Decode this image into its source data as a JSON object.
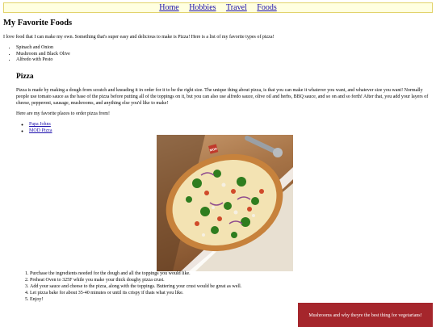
{
  "nav": {
    "items": [
      {
        "label": "Home"
      },
      {
        "label": "Hobbies"
      },
      {
        "label": "Travel"
      },
      {
        "label": "Foods"
      }
    ]
  },
  "page": {
    "title": "My Favorite Foods",
    "intro": "I love food that I can make my own. Something that's super easy and delicious to make is Pizza! Here is a list of my favorite types of pizza!"
  },
  "foods": [
    "Spinach and Onion",
    "Mushroom and Black Olive",
    "Alfredo with Pesto"
  ],
  "pizza": {
    "heading": "Pizza",
    "description": "Pizza is made by making a dough from scratch and kneading it in order for it to be the right size. The unique thing about pizza, is that you can make it whatever you want, and whatever size you want! Normally people use tomato sauce as the base of the pizza before putting all of the toppings on it, but you can also use alfredo sauce, olive oil and herbs, BBQ sauce, and so on and so forth! After that, you add your layers of cheese, pepperoni, sausage, mushrooms, and anything else you'd like to make!",
    "places_intro": "Here are my favorite places to order pizza from!",
    "places": [
      {
        "label": "Papa Johns"
      },
      {
        "label": "MOD Pizza"
      }
    ],
    "image_logo": "MOD"
  },
  "steps": [
    "Purchase the ingredients needed for the dough and all the toppings you would like.",
    "Preheat Oven to 325F while you make your thick doughy pizza crust.",
    "Add your sauce and cheese to the pizza, along with the toppings. Buttering your crust would be great as well.",
    "Let pizza bake for about 35-40 minutes or until its crispy if thats what you like.",
    "Enjoy!"
  ],
  "promo": {
    "text": "Mushrooms and why theyre the best thing for vegetarians!"
  },
  "colors": {
    "nav_bg": "#ffffe0",
    "promo_bg": "#a5262c",
    "link": "#1a0dab"
  }
}
